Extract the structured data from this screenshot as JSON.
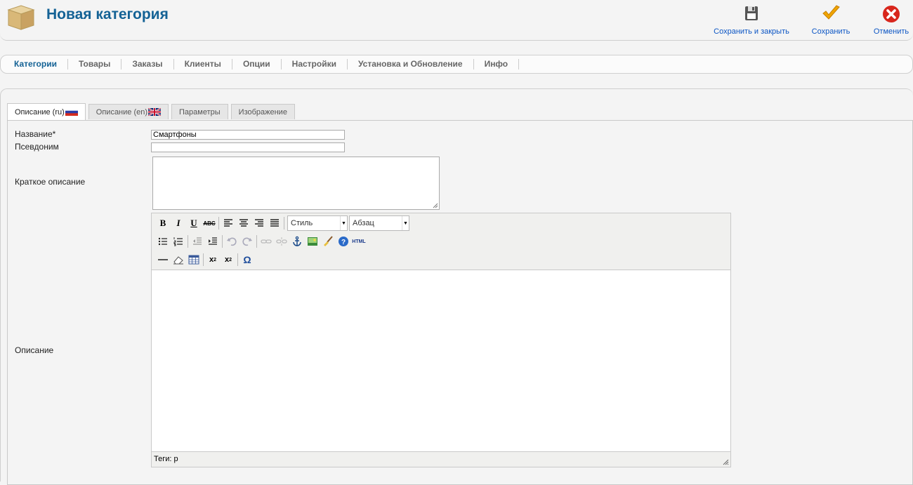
{
  "header": {
    "title": "Новая категория",
    "logo_icon": "package-icon",
    "actions": [
      {
        "label": "Сохранить и закрыть",
        "icon": "floppy-disk-icon"
      },
      {
        "label": "Сохранить",
        "icon": "checkmark-icon"
      },
      {
        "label": "Отменить",
        "icon": "cancel-icon"
      }
    ]
  },
  "menu": {
    "items": [
      "Категории",
      "Товары",
      "Заказы",
      "Клиенты",
      "Опции",
      "Настройки",
      "Установка и Обновление",
      "Инфо"
    ],
    "active": "Категории"
  },
  "tabs": [
    {
      "label": "Описание (ru)",
      "flag": "russia-flag-icon",
      "active": true
    },
    {
      "label": "Описание (en)",
      "flag": "uk-flag-icon",
      "active": false
    },
    {
      "label": "Параметры",
      "active": false
    },
    {
      "label": "Изображение",
      "active": false
    }
  ],
  "form": {
    "name_label": "Название*",
    "name_value": "Смартфоны",
    "alias_label": "Псевдоним",
    "alias_value": "",
    "short_desc_label": "Краткое описание",
    "short_desc_value": "",
    "desc_label": "Описание"
  },
  "editor": {
    "style_select": "Стиль",
    "paragraph_select": "Абзац",
    "html_button": "HTML",
    "status": "Теги: p",
    "colors": {
      "toolbar": "#f0f0ee",
      "border": "#c9c9c9"
    }
  },
  "colors": {
    "title": "#146295",
    "link": "#0b55c4",
    "background": "#f4f4f4"
  }
}
